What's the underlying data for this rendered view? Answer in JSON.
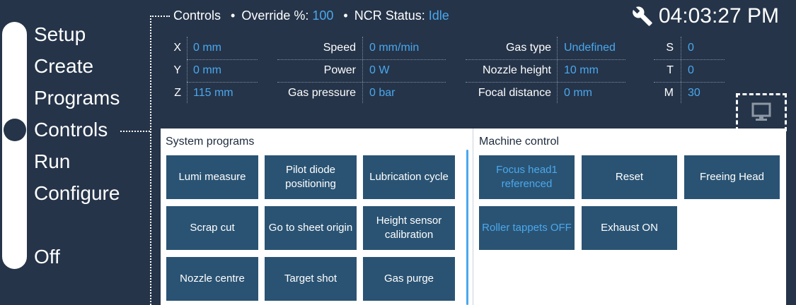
{
  "nav": {
    "items": [
      {
        "label": "Setup"
      },
      {
        "label": "Create"
      },
      {
        "label": "Programs"
      },
      {
        "label": "Controls"
      },
      {
        "label": "Run"
      },
      {
        "label": "Configure"
      },
      {
        "label": "Off"
      }
    ],
    "selected": "Controls"
  },
  "header": {
    "section": "Controls",
    "override_label": "Override %:",
    "override_value": "100",
    "ncr_label": "NCR Status:",
    "ncr_value": "Idle",
    "clock": "04:03:27 PM"
  },
  "readouts": {
    "axes": [
      {
        "label": "X",
        "value": "0 mm"
      },
      {
        "label": "Y",
        "value": "0 mm"
      },
      {
        "label": "Z",
        "value": "115 mm"
      }
    ],
    "process": [
      {
        "label": "Speed",
        "value": "0 mm/min"
      },
      {
        "label": "Power",
        "value": "0 W"
      },
      {
        "label": "Gas pressure",
        "value": "0 bar"
      }
    ],
    "head": [
      {
        "label": "Gas type",
        "value": "Undefined"
      },
      {
        "label": "Nozzle height",
        "value": "10 mm"
      },
      {
        "label": "Focal distance",
        "value": "0 mm"
      }
    ],
    "codes": [
      {
        "label": "S",
        "value": "0"
      },
      {
        "label": "T",
        "value": "0"
      },
      {
        "label": "M",
        "value": "30"
      }
    ]
  },
  "system_programs": {
    "title": "System programs",
    "buttons": [
      "Lumi measure",
      "Pilot diode\npositioning",
      "Lubrication cycle",
      "Scrap cut",
      "Go to sheet origin",
      "Height sensor\ncalibration",
      "Nozzle centre",
      "Target shot",
      "Gas purge"
    ]
  },
  "machine_control": {
    "title": "Machine control",
    "buttons": [
      "Focus head1\nreferenced",
      "Reset",
      "Freeing Head",
      "Roller tappets OFF",
      "Exhaust ON"
    ]
  },
  "colors": {
    "background": "#253449",
    "accent": "#4aa8ee",
    "button": "#2a5373"
  },
  "icons": [
    "wrench-icon",
    "monitor-icon"
  ]
}
